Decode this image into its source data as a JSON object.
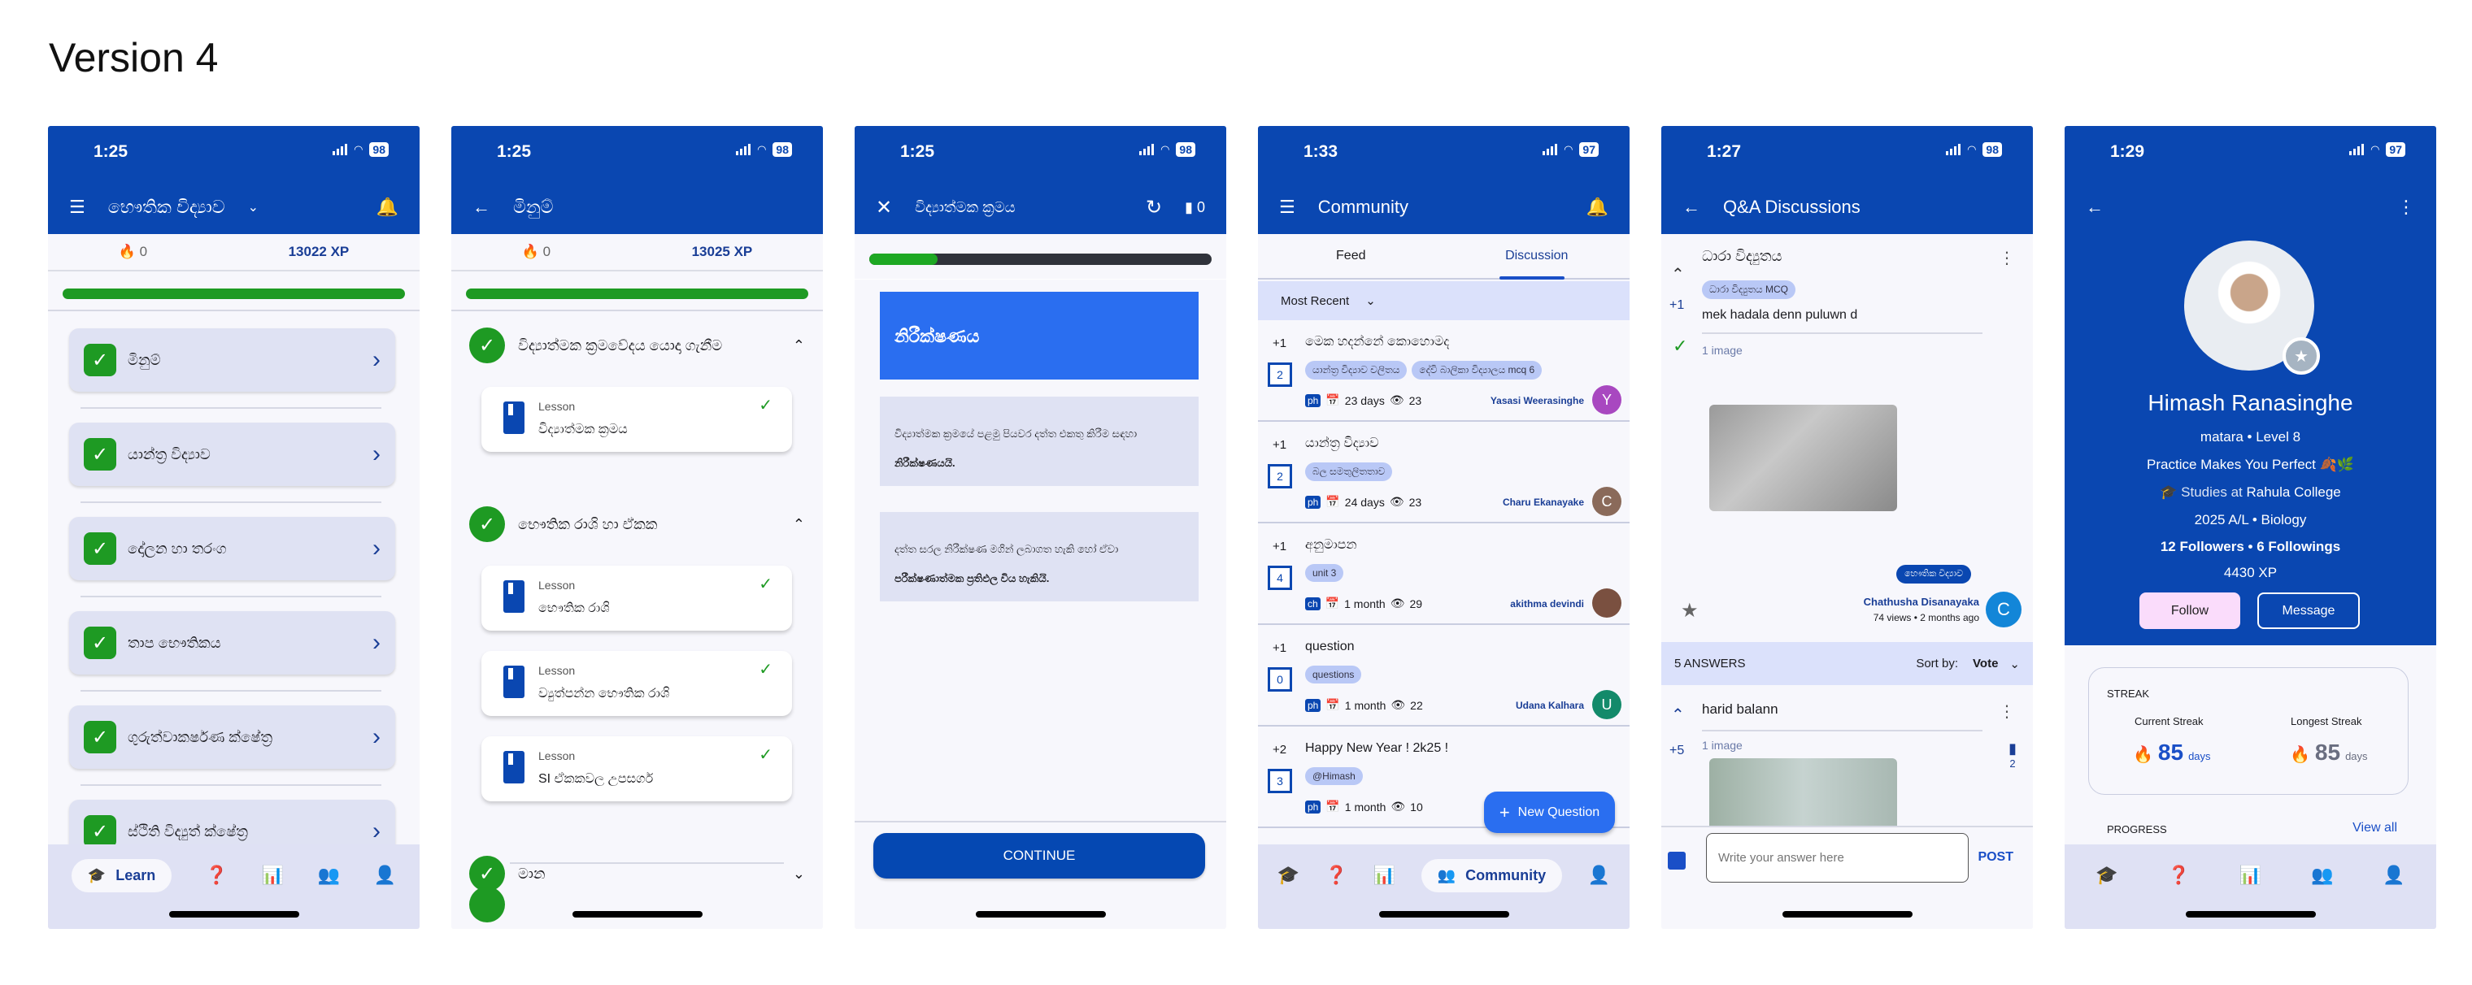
{
  "page_title": "Version 4",
  "colors": {
    "primary": "#0a47b1",
    "success": "#1e9a23",
    "card": "#dfe2f3",
    "chip": "#b9c8f6",
    "fab": "#2a6ef0"
  },
  "screens": [
    {
      "status": {
        "time": "1:25",
        "battery": "98"
      },
      "header": {
        "title": "භෞතික විද්‍යාව"
      },
      "stats": {
        "streak": "0",
        "xp": "13022 XP"
      },
      "units": [
        {
          "label": "මිනුම්"
        },
        {
          "label": "යාන්ත්‍ර විද්‍යාව"
        },
        {
          "label": "දෝලන හා තරංග"
        },
        {
          "label": "තාප භෞතිකය"
        },
        {
          "label": "ගුරුත්වාකර්ෂණ ක්ෂේත්‍ර"
        },
        {
          "label": "ස්ථිති විද්‍යුත් ක්ෂේත්‍ර"
        }
      ],
      "nav": {
        "active_label": "Learn"
      }
    },
    {
      "status": {
        "time": "1:25",
        "battery": "98"
      },
      "header": {
        "title": "මිනුම්"
      },
      "stats": {
        "streak": "0",
        "xp": "13025 XP"
      },
      "lesson_kind": "Lesson",
      "sections": [
        {
          "title": "විද්‍යාත්මක ක්‍රමවේදය යොදා ගැනීම",
          "expanded": true,
          "lessons": [
            "විද්‍යාත්මක ක්‍රමය"
          ]
        },
        {
          "title": "භෞතික රාශි හා ඒකක",
          "expanded": true,
          "lessons": [
            "භෞතික රාශි",
            "ව්‍යුත්පන්න භෞතික රාශි",
            "SI ඒකකවල උපසර්ග"
          ]
        },
        {
          "title": "මාන",
          "expanded": false,
          "lessons": []
        }
      ]
    },
    {
      "status": {
        "time": "1:25",
        "battery": "98"
      },
      "header": {
        "title": "විද්‍යාත්මක ක්‍රමය",
        "comment_count": "0"
      },
      "progress": 0.2,
      "heading": "නිරීක්ෂණය",
      "paragraphs": [
        {
          "text": "විද්‍යාත්මක ක්‍රමයේ පළමු පියවර දත්ත එකතු කිරීම සඳහා",
          "bold": "නිරීක්ෂණයයි."
        },
        {
          "text": "දත්ත සරල නිරීක්ෂණ මගින් ලබාගත හැකි හෝ ඒවා",
          "bold": "පරීක්ෂණාත්මක ප්‍රතිඵල විය හැකියි."
        }
      ],
      "continue_label": "CONTINUE"
    },
    {
      "status": {
        "time": "1:33",
        "battery": "97"
      },
      "header": {
        "title": "Community"
      },
      "tabs": [
        {
          "label": "Feed",
          "active": false
        },
        {
          "label": "Discussion",
          "active": true
        }
      ],
      "sort": "Most Recent",
      "posts": [
        {
          "votes": "+1",
          "title": "මෙක හදන්නේ කොහොමද",
          "tags": [
            "යාන්ත්‍ර විද්‍යාව  චලිතය",
            "දේවි බාලිකා විද්‍යාලය mcq 6"
          ],
          "comments": "2",
          "subject": "ph",
          "age": "23 days",
          "views": "23",
          "author": "Yasasi Weerasinghe",
          "avatar": "Y",
          "avatar_color": "#a848c0"
        },
        {
          "votes": "+1",
          "title": "යාන්ත්‍ර විද්‍යාව",
          "tags": [
            "බල සමතුලිතතාව"
          ],
          "comments": "2",
          "subject": "ph",
          "age": "24 days",
          "views": "23",
          "author": "Charu Ekanayake",
          "avatar": "C",
          "avatar_color": "#8a6a5a"
        },
        {
          "votes": "+1",
          "title": "අනුමාපන",
          "tags": [
            "unit 3"
          ],
          "comments": "4",
          "subject": "ch",
          "age": "1 month",
          "views": "29",
          "author": "akithma devindi",
          "avatar": "",
          "avatar_color": "#7a5040"
        },
        {
          "votes": "+1",
          "title": "question",
          "tags": [
            "questions"
          ],
          "comments": "0",
          "subject": "ph",
          "age": "1 month",
          "views": "22",
          "author": "Udana Kalhara",
          "avatar": "U",
          "avatar_color": "#138a6a"
        },
        {
          "votes": "+2",
          "title": "Happy New Year ! 2k25 !",
          "tags": [
            "@Himash"
          ],
          "comments": "3",
          "subject": "ph",
          "age": "1 month",
          "views": "10",
          "author": "",
          "avatar": "",
          "avatar_color": ""
        }
      ],
      "fab_label": "New Question",
      "nav": {
        "active_label": "Community"
      }
    },
    {
      "status": {
        "time": "1:27",
        "battery": "98"
      },
      "header": {
        "title": "Q&A Discussions"
      },
      "question": {
        "title": "ධාරා විද්‍යුතය",
        "tag": "ධාරා විද්‍යුතය MCQ",
        "votes": "+1",
        "body": "mek hadala denn puluwn d",
        "images": "1 image",
        "subject_tag": "භෞතික විද්‍යාව",
        "author": "Chathusha Disanayaka",
        "meta": "74 views • 2 months ago",
        "avatar": "C"
      },
      "answers_header": {
        "count": "5 ANSWERS",
        "sort_label": "Sort by:",
        "sort_value": "Vote"
      },
      "answer": {
        "body": "harid balann",
        "votes": "+5",
        "images": "1 image",
        "comments": "2"
      },
      "composer": {
        "placeholder": "Write your answer here",
        "post_label": "POST"
      }
    },
    {
      "status": {
        "time": "1:29",
        "battery": "97"
      },
      "profile": {
        "name": "Himash Ranasinghe",
        "location_level": "matara • Level 8",
        "bio": "Practice Makes You Perfect 🍂🌿",
        "studies_label": "Studies at",
        "school": "Rahula College",
        "batch": "2025 A/L • Biology",
        "follows": "12 Followers • 6 Followings",
        "xp": "4430 XP",
        "follow_label": "Follow",
        "message_label": "Message"
      },
      "streak": {
        "title": "STREAK",
        "current_label": "Current Streak",
        "current_value": "85",
        "longest_label": "Longest Streak",
        "longest_value": "85",
        "unit": "days"
      },
      "progress": {
        "title": "PROGRESS",
        "view_all": "View all"
      }
    }
  ]
}
